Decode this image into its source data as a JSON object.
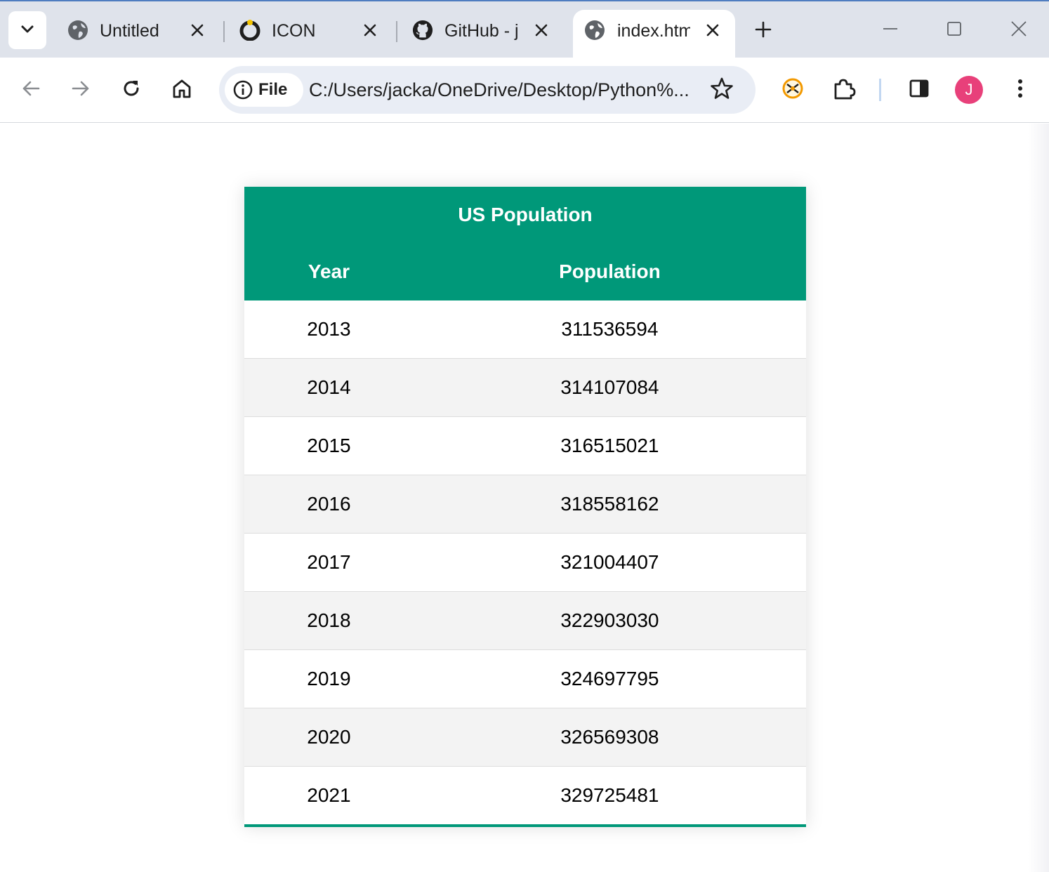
{
  "browser": {
    "tabs": [
      {
        "title": "Untitled",
        "favicon": "globe-icon",
        "active": false
      },
      {
        "title": "ICON",
        "favicon": "icon-site-favicon",
        "active": false
      },
      {
        "title": "GitHub - j",
        "favicon": "github-icon",
        "active": false
      },
      {
        "title": "index.htm",
        "favicon": "globe-icon",
        "active": true
      }
    ],
    "security_chip_label": "File",
    "url": "C:/Users/jacka/OneDrive/Desktop/Python%...",
    "profile_initial": "J",
    "accent_colors": {
      "avatar": "#e8407a",
      "tabstrip": "#dfe3eb",
      "omnibox": "#e9edf5"
    }
  },
  "page": {
    "table": {
      "caption": "US Population",
      "headers": [
        "Year",
        "Population"
      ],
      "rows": [
        [
          "2013",
          "311536594"
        ],
        [
          "2014",
          "314107084"
        ],
        [
          "2015",
          "316515021"
        ],
        [
          "2016",
          "318558162"
        ],
        [
          "2017",
          "321004407"
        ],
        [
          "2018",
          "322903030"
        ],
        [
          "2019",
          "324697795"
        ],
        [
          "2020",
          "326569308"
        ],
        [
          "2021",
          "329725481"
        ]
      ],
      "header_color": "#009879",
      "stripe_color": "#f3f3f3"
    }
  }
}
